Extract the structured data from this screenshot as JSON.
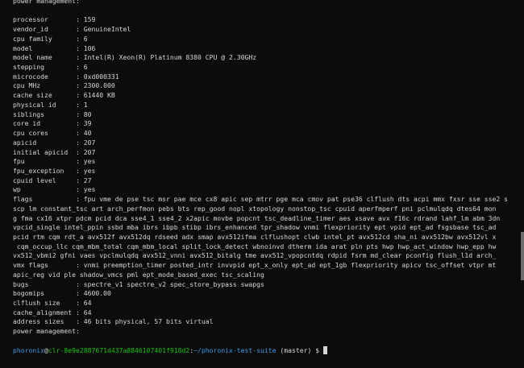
{
  "terminal": {
    "top_line": "power management:",
    "fields": [
      {
        "key": "processor",
        "value": "159"
      },
      {
        "key": "vendor_id",
        "value": "GenuineIntel"
      },
      {
        "key": "cpu family",
        "value": "6"
      },
      {
        "key": "model",
        "value": "106"
      },
      {
        "key": "model name",
        "value": "Intel(R) Xeon(R) Platinum 8380 CPU @ 2.30GHz"
      },
      {
        "key": "stepping",
        "value": "6"
      },
      {
        "key": "microcode",
        "value": "0xd000331"
      },
      {
        "key": "cpu MHz",
        "value": "2300.000"
      },
      {
        "key": "cache size",
        "value": "61440 KB"
      },
      {
        "key": "physical id",
        "value": "1"
      },
      {
        "key": "siblings",
        "value": "80"
      },
      {
        "key": "core id",
        "value": "39"
      },
      {
        "key": "cpu cores",
        "value": "40"
      },
      {
        "key": "apicid",
        "value": "207"
      },
      {
        "key": "initial apicid",
        "value": "207"
      },
      {
        "key": "fpu",
        "value": "yes"
      },
      {
        "key": "fpu_exception",
        "value": "yes"
      },
      {
        "key": "cpuid level",
        "value": "27"
      },
      {
        "key": "wp",
        "value": "yes"
      }
    ],
    "flags_key": "flags",
    "flags_lines": [
      "fpu vme de pse tsc msr pae mce cx8 apic sep mtrr pge mca cmov pat pse36 clflush dts acpi mmx fxsr sse sse2 s",
      "scp lm constant_tsc art arch_perfmon pebs bts rep_good nopl xtopology nonstop_tsc cpuid aperfmperf pni pclmulqdq dtes64 mon",
      "g fma cx16 xtpr pdcm pcid dca sse4_1 sse4_2 x2apic movbe popcnt tsc_deadline_timer aes xsave avx f16c rdrand lahf_lm abm 3dn",
      "vpcid_single intel_ppin ssbd mba ibrs ibpb stibp ibrs_enhanced tpr_shadow vnmi flexpriority ept vpid ept_ad fsgsbase tsc_ad",
      "pcid rtm cqm rdt_a avx512f avx512dq rdseed adx smap avx512ifma clflushopt clwb intel_pt avx512cd sha_ni avx512bw avx512vl x",
      " cqm_occup_llc cqm_mbm_total cqm_mbm_local split_lock_detect wbnoinvd dtherm ida arat pln pts hwp hwp_act_window hwp_epp hw",
      "vx512_vbmi2 gfni vaes vpclmulqdq avx512_vnni avx512_bitalg tme avx512_vpopcntdq rdpid fsrm md_clear pconfig flush_l1d arch_"
    ],
    "vmx_key": "vmx flags",
    "vmx_lines": [
      "vnmi preemption_timer posted_intr invvpid ept_x_only ept_ad ept_1gb flexpriority apicv tsc_offset vtpr mt",
      "apic_reg vid ple shadow_vmcs pml ept_mode_based_exec tsc_scaling"
    ],
    "fields_after": [
      {
        "key": "bugs",
        "value": "spectre_v1 spectre_v2 spec_store_bypass swapgs"
      },
      {
        "key": "bogomips",
        "value": "4600.00"
      },
      {
        "key": "clflush size",
        "value": "64"
      },
      {
        "key": "cache_alignment",
        "value": "64"
      },
      {
        "key": "address sizes",
        "value": "46 bits physical, 57 bits virtual"
      }
    ],
    "bottom_line": "power management:",
    "prompt": {
      "user": "phoronix",
      "at": "@",
      "host": "clr-8e9e2887671d437a8846107401f918d2",
      "colon": ":",
      "path": "~/phoronix-test-suite",
      "branch": " (master) $ "
    }
  }
}
